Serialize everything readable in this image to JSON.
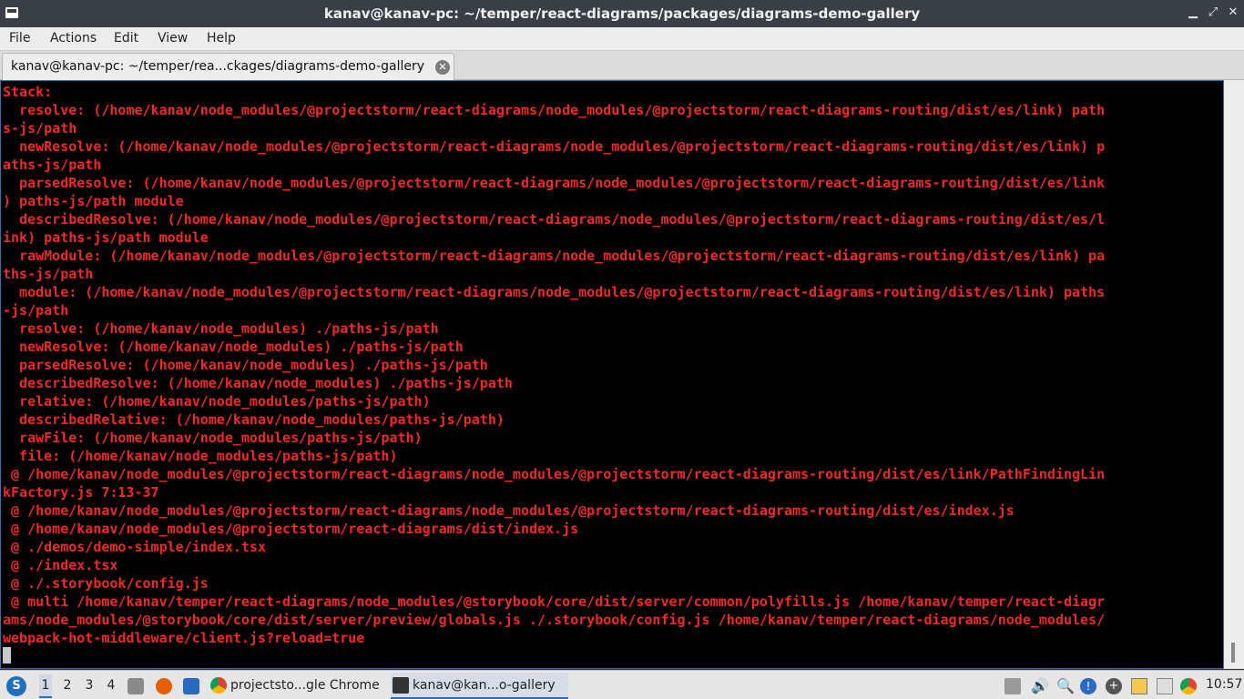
{
  "window": {
    "title": "kanav@kanav-pc: ~/temper/react-diagrams/packages/diagrams-demo-gallery",
    "minimize": "▁",
    "maximize": "⤢",
    "close": "✕"
  },
  "menu": [
    "File",
    "Actions",
    "Edit",
    "View",
    "Help"
  ],
  "tab": {
    "label": "kanav@kanav-pc: ~/temper/rea...ckages/diagrams-demo-gallery",
    "close_glyph": "✕"
  },
  "terminal": {
    "text_color": "#ef2929",
    "lines": [
      "Stack:",
      "  resolve: (/home/kanav/node_modules/@projectstorm/react-diagrams/node_modules/@projectstorm/react-diagrams-routing/dist/es/link) path",
      "s-js/path",
      "  newResolve: (/home/kanav/node_modules/@projectstorm/react-diagrams/node_modules/@projectstorm/react-diagrams-routing/dist/es/link) p",
      "aths-js/path",
      "  parsedResolve: (/home/kanav/node_modules/@projectstorm/react-diagrams/node_modules/@projectstorm/react-diagrams-routing/dist/es/link",
      ") paths-js/path module",
      "  describedResolve: (/home/kanav/node_modules/@projectstorm/react-diagrams/node_modules/@projectstorm/react-diagrams-routing/dist/es/l",
      "ink) paths-js/path module",
      "  rawModule: (/home/kanav/node_modules/@projectstorm/react-diagrams/node_modules/@projectstorm/react-diagrams-routing/dist/es/link) pa",
      "ths-js/path",
      "  module: (/home/kanav/node_modules/@projectstorm/react-diagrams/node_modules/@projectstorm/react-diagrams-routing/dist/es/link) paths",
      "-js/path",
      "  resolve: (/home/kanav/node_modules) ./paths-js/path",
      "  newResolve: (/home/kanav/node_modules) ./paths-js/path",
      "  parsedResolve: (/home/kanav/node_modules) ./paths-js/path",
      "  describedResolve: (/home/kanav/node_modules) ./paths-js/path",
      "  relative: (/home/kanav/node_modules/paths-js/path)",
      "  describedRelative: (/home/kanav/node_modules/paths-js/path)",
      "  rawFile: (/home/kanav/node_modules/paths-js/path)",
      "  file: (/home/kanav/node_modules/paths-js/path)",
      " @ /home/kanav/node_modules/@projectstorm/react-diagrams/node_modules/@projectstorm/react-diagrams-routing/dist/es/link/PathFindingLin",
      "kFactory.js 7:13-37",
      " @ /home/kanav/node_modules/@projectstorm/react-diagrams/node_modules/@projectstorm/react-diagrams-routing/dist/es/index.js",
      " @ /home/kanav/node_modules/@projectstorm/react-diagrams/dist/index.js",
      " @ ./demos/demo-simple/index.tsx",
      " @ ./index.tsx",
      " @ ./.storybook/config.js",
      " @ multi /home/kanav/temper/react-diagrams/node_modules/@storybook/core/dist/server/common/polyfills.js /home/kanav/temper/react-diagr",
      "ams/node_modules/@storybook/core/dist/server/preview/globals.js ./.storybook/config.js /home/kanav/temper/react-diagrams/node_modules/",
      "webpack-hot-middleware/client.js?reload=true"
    ]
  },
  "taskbar": {
    "start_glyph": "S",
    "workspaces": [
      "1",
      "2",
      "3",
      "4"
    ],
    "active_workspace": "1",
    "tasks": [
      {
        "label": "projectsto...gle Chrome",
        "icon": "chrome-icon"
      },
      {
        "label": "kanav@kan...o-gallery",
        "icon": "terminal-icon"
      }
    ],
    "clock": "10:57"
  }
}
